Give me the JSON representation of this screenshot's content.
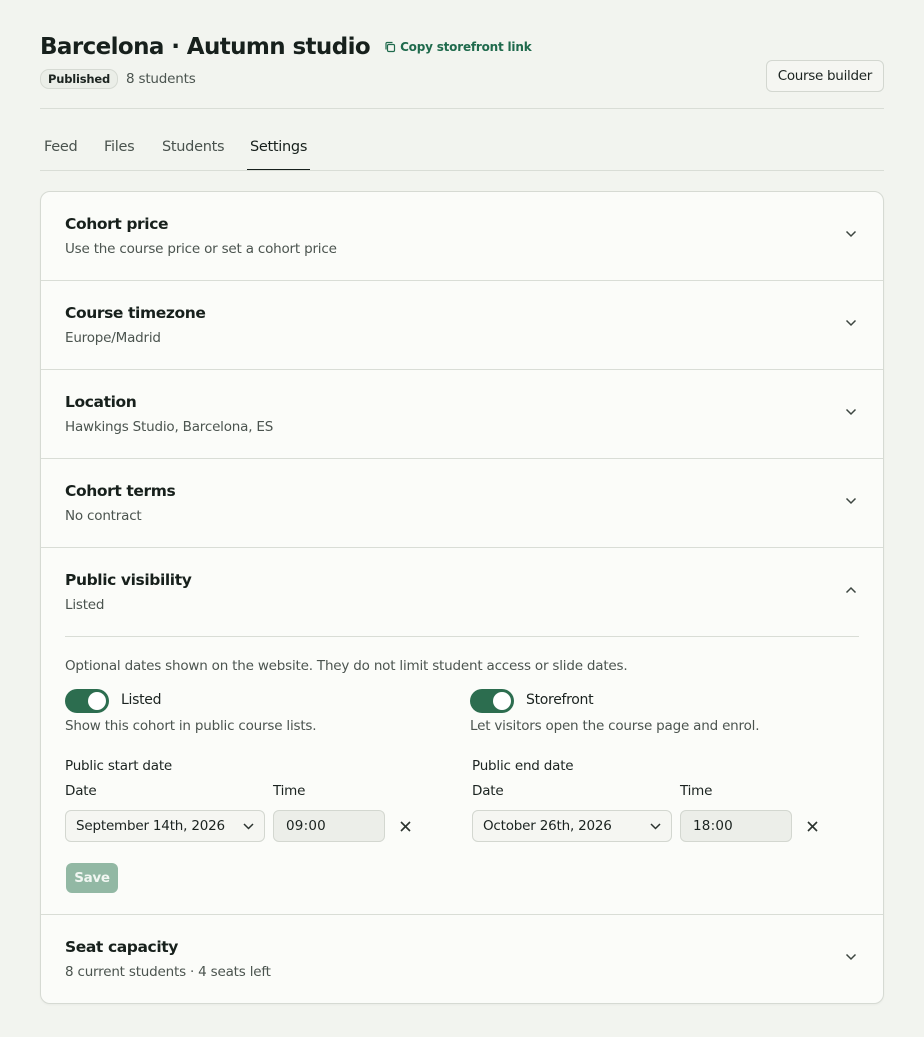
{
  "header": {
    "title": "Barcelona · Autumn studio",
    "copy_link": "Copy storefront link",
    "status_badge": "Published",
    "student_count": "8 students",
    "builder_button": "Course builder"
  },
  "tabs": [
    {
      "label": "Feed"
    },
    {
      "label": "Files"
    },
    {
      "label": "Students"
    },
    {
      "label": "Settings",
      "active": true
    }
  ],
  "sections": [
    {
      "title": "Cohort price",
      "subtitle": "Use the course price or set a cohort price"
    },
    {
      "title": "Course timezone",
      "subtitle": "Europe/Madrid"
    },
    {
      "title": "Location",
      "subtitle": "Hawkings Studio, Barcelona, ES"
    },
    {
      "title": "Cohort terms",
      "subtitle": "No contract"
    }
  ],
  "visibility": {
    "title": "Public visibility",
    "subtitle": "Listed",
    "description": "Optional dates shown on the website. They do not limit student access or slide dates.",
    "listed": {
      "label": "Listed",
      "help": "Show this cohort in public course lists.",
      "on": true
    },
    "storefront": {
      "label": "Storefront",
      "help": "Let visitors open the course page and enrol.",
      "on": true
    },
    "start": {
      "heading": "Public start date",
      "date_label": "Date",
      "time_label": "Time",
      "date": "September 14th, 2026",
      "time": "09:00"
    },
    "end": {
      "heading": "Public end date",
      "date_label": "Date",
      "time_label": "Time",
      "date": "October 26th, 2026",
      "time": "18:00"
    },
    "save_label": "Save"
  },
  "seat_capacity": {
    "title": "Seat capacity",
    "subtitle": "8 current students · 4 seats left"
  },
  "colors": {
    "accent": "#2c6d4f",
    "save_disabled": "#92b8a4",
    "background": "#f2f4ef"
  }
}
